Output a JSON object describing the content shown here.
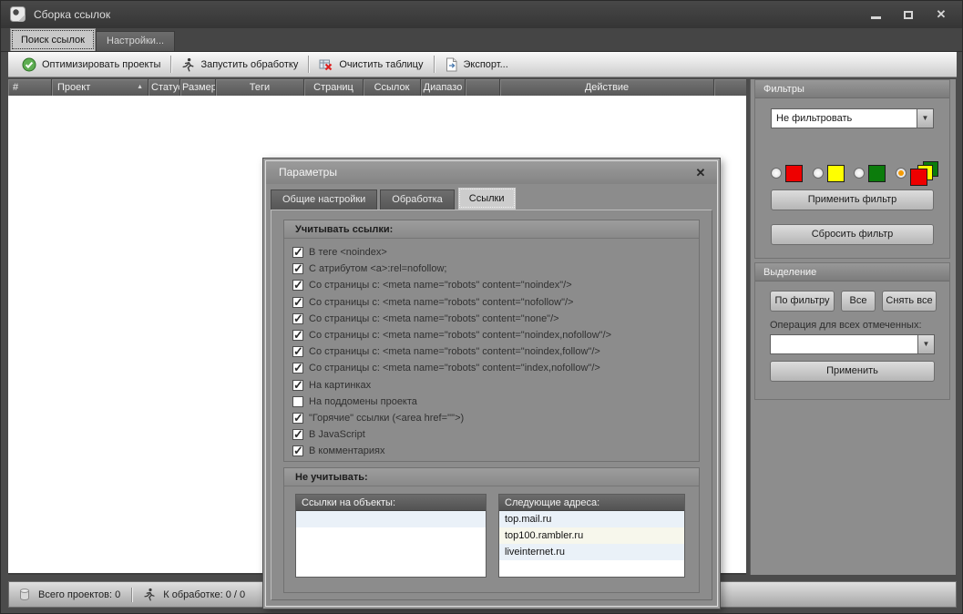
{
  "window": {
    "title": "Сборка ссылок"
  },
  "icons": {
    "close": "✕",
    "dropdown_arrow": "▼"
  },
  "main_tabs": {
    "search": "Поиск ссылок",
    "settings": "Настройки..."
  },
  "toolbar": {
    "buttons": [
      {
        "label": "Оптимизировать проекты",
        "icon": "optimize-check-icon"
      },
      {
        "label": "Запустить обработку",
        "icon": "run-man-icon"
      },
      {
        "label": "Очистить таблицу",
        "icon": "clear-table-icon"
      },
      {
        "label": "Экспорт...",
        "icon": "export-icon"
      }
    ]
  },
  "table": {
    "columns": [
      {
        "label": "#"
      },
      {
        "label": "Проект",
        "sorted": true
      },
      {
        "label": "Статус"
      },
      {
        "label": "Размер"
      },
      {
        "label": "Теги"
      },
      {
        "label": "Страниц"
      },
      {
        "label": "Ссылок"
      },
      {
        "label": "Диапазо"
      },
      {
        "label": ""
      },
      {
        "label": "Действие"
      },
      {
        "label": ""
      }
    ]
  },
  "filters": {
    "title": "Фильтры",
    "combo_value": "Не фильтровать",
    "colors": {
      "red": "#ee0000",
      "yellow": "#ffff00",
      "green": "#0c7c0c"
    },
    "selected_index": 3,
    "apply_label": "Применить фильтр",
    "reset_label": "Сбросить фильтр"
  },
  "selection": {
    "title": "Выделение",
    "buttons": [
      "По фильтру",
      "Все",
      "Снять все"
    ],
    "operation_label": "Операция для всех отмеченных:",
    "operation_value": "",
    "apply_label": "Применить"
  },
  "statusbar": {
    "projects_total": "Всего проектов: 0",
    "processing": "К обработке: 0  /  0"
  },
  "dialog": {
    "title": "Параметры",
    "tabs": {
      "general": "Общие настройки",
      "processing": "Обработка",
      "links": "Ссылки"
    },
    "include_group": {
      "title": "Учитывать ссылки:",
      "items": [
        {
          "label": "В теге <noindex>",
          "checked": true
        },
        {
          "label": "С атрибутом <a>:rel=nofollow;",
          "checked": true
        },
        {
          "label": "Со страницы с: <meta name=\"robots\" content=\"noindex\"/>",
          "checked": true
        },
        {
          "label": "Со страницы с: <meta name=\"robots\" content=\"nofollow\"/>",
          "checked": true
        },
        {
          "label": "Со страницы с: <meta name=\"robots\" content=\"none\"/>",
          "checked": true
        },
        {
          "label": "Со страницы с: <meta name=\"robots\" content=\"noindex,nofollow\"/>",
          "checked": true
        },
        {
          "label": "Со страницы с: <meta name=\"robots\" content=\"noindex,follow\"/>",
          "checked": true
        },
        {
          "label": "Со страницы с: <meta name=\"robots\" content=\"index,nofollow\"/>",
          "checked": true
        },
        {
          "label": "На картинках",
          "checked": true
        },
        {
          "label": "На поддомены проекта",
          "checked": false
        },
        {
          "label": "\"Горячие\" ссылки (<area href='\"'>)",
          "checked": true
        },
        {
          "label": "В JavaScript",
          "checked": true
        },
        {
          "label": "В комментариях",
          "checked": true
        }
      ]
    },
    "exclude_group": {
      "title": "Не учитывать:",
      "objects_list": {
        "header": "Ссылки на объекты:",
        "items": []
      },
      "addresses_list": {
        "header": "Следующие адреса:",
        "items": [
          "top.mail.ru",
          "top100.rambler.ru",
          "liveinternet.ru"
        ]
      }
    }
  }
}
